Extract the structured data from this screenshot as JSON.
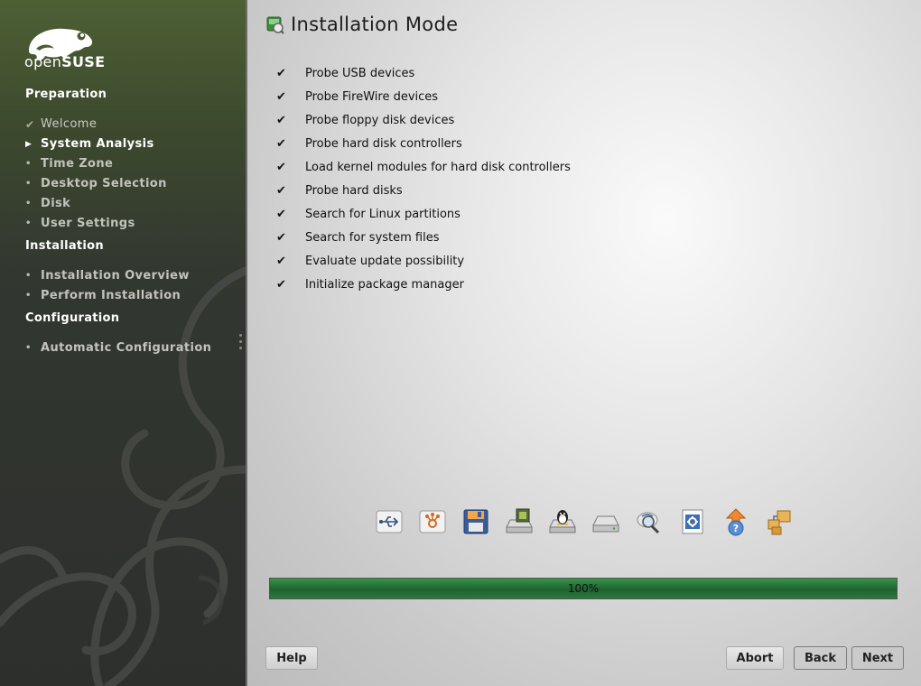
{
  "sidebar": {
    "logo_text_light": "open",
    "logo_text_bold": "SUSE",
    "sections": [
      {
        "title": "Preparation"
      },
      {
        "title": "Installation"
      },
      {
        "title": "Configuration"
      }
    ],
    "steps": [
      {
        "label": "Welcome",
        "state": "done"
      },
      {
        "label": "System Analysis",
        "state": "active"
      },
      {
        "label": "Time Zone",
        "state": "todo"
      },
      {
        "label": "Desktop Selection",
        "state": "todo"
      },
      {
        "label": "Disk",
        "state": "todo"
      },
      {
        "label": "User Settings",
        "state": "todo"
      },
      {
        "label": "Installation Overview",
        "state": "todo"
      },
      {
        "label": "Perform Installation",
        "state": "todo"
      },
      {
        "label": "Automatic Configuration",
        "state": "todo"
      }
    ],
    "bullet": "•",
    "active_marker": "▶",
    "done_marker": "✔"
  },
  "main": {
    "title": "Installation Mode",
    "check_glyph": "✔",
    "checklist": [
      "Probe USB devices",
      "Probe FireWire devices",
      "Probe floppy disk devices",
      "Probe hard disk controllers",
      "Load kernel modules for hard disk controllers",
      "Probe hard disks",
      "Search for Linux partitions",
      "Search for system files",
      "Evaluate update possibility",
      "Initialize package manager"
    ],
    "progress": {
      "value": 100,
      "label": "100%"
    },
    "stage_icons": [
      "usb-icon",
      "firewire-icon",
      "floppy-icon",
      "disk-controller-icon",
      "linux-tux-icon",
      "hard-disk-icon",
      "search-partitions-icon",
      "system-files-icon",
      "update-icon",
      "package-manager-icon"
    ]
  },
  "buttons": {
    "help": "Help",
    "abort": "Abort",
    "back": "Back",
    "next": "Next"
  }
}
